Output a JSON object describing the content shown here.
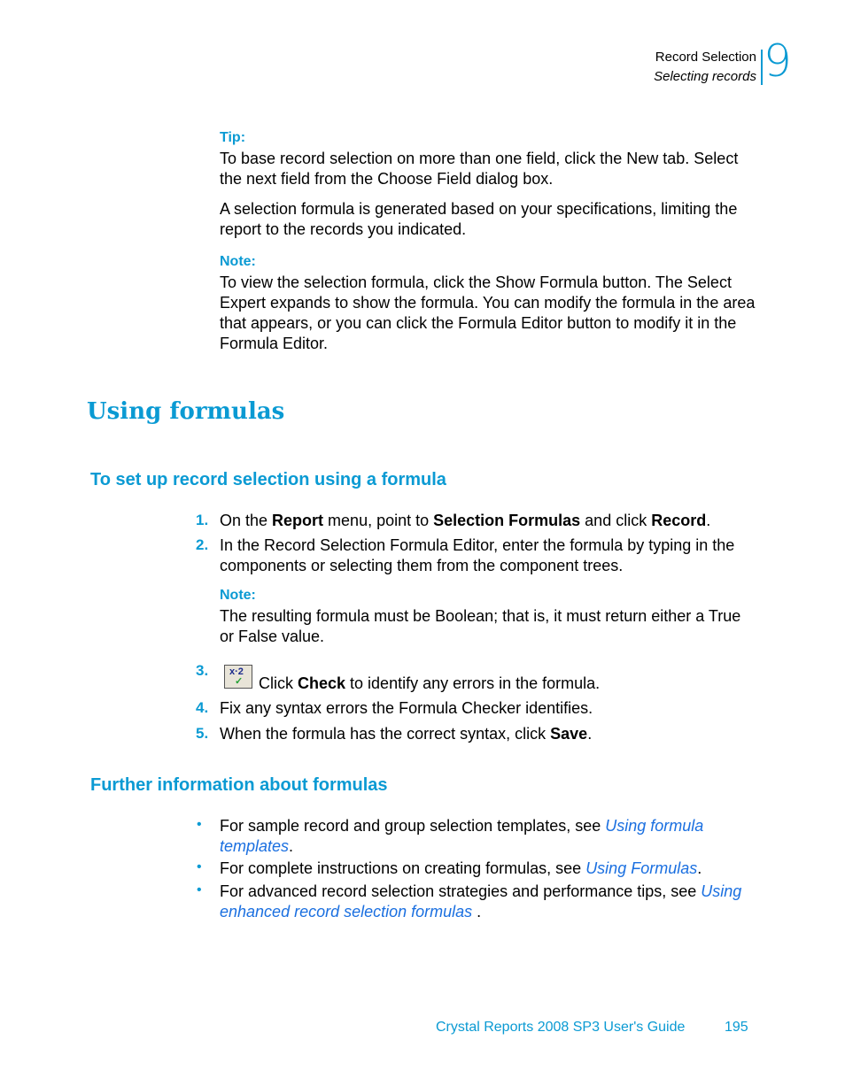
{
  "header": {
    "chapter_title": "Record Selection",
    "section_title": "Selecting records",
    "chapter_number": "9"
  },
  "tip": {
    "label": "Tip:",
    "text": "To base record selection on more than one field, click the New tab. Select the next field from the Choose Field dialog box."
  },
  "paragraph1": "A selection formula is generated based on your specifications, limiting the report to the records you indicated.",
  "note1": {
    "label": "Note:",
    "text": "To view the selection formula, click the Show Formula button. The Select Expert expands to show the formula. You can modify the formula in the area that appears, or you can click the Formula Editor button to modify it in the Formula Editor."
  },
  "heading_main": "Using formulas",
  "procedure": {
    "heading": "To set up record selection using a formula",
    "steps": [
      {
        "num": "1.",
        "parts": [
          "On the ",
          "Report",
          " menu, point to ",
          "Selection Formulas",
          " and click ",
          "Record",
          "."
        ]
      },
      {
        "num": "2.",
        "text": "In the Record Selection Formula Editor, enter the formula by typing in the components or selecting them from the component trees."
      },
      {
        "num": "3.",
        "parts": [
          "Click ",
          "Check",
          " to identify any errors in the formula."
        ],
        "icon": "formula-check-icon",
        "icon_text": "x·2"
      },
      {
        "num": "4.",
        "text": "Fix any syntax errors the Formula Checker identifies."
      },
      {
        "num": "5.",
        "parts": [
          "When the formula has the correct syntax, click ",
          "Save",
          "."
        ]
      }
    ],
    "note": {
      "label": "Note:",
      "text": "The resulting formula must be Boolean; that is, it must return either a True or False value."
    }
  },
  "further": {
    "heading": "Further information about formulas",
    "bullets": [
      {
        "prefix": "For sample record and group selection templates, see ",
        "link": "Using formula templates",
        "suffix": "."
      },
      {
        "prefix": "For complete instructions on creating formulas, see ",
        "link": "Using Formulas",
        "suffix": "."
      },
      {
        "prefix": "For advanced record selection strategies and performance tips, see ",
        "link": "Using enhanced record selection formulas",
        "suffix": " ."
      }
    ]
  },
  "footer": {
    "guide_title": "Crystal Reports 2008 SP3 User's Guide",
    "page_number": "195"
  },
  "colors": {
    "accent": "#0a9ad3",
    "link": "#1a6fe0"
  }
}
